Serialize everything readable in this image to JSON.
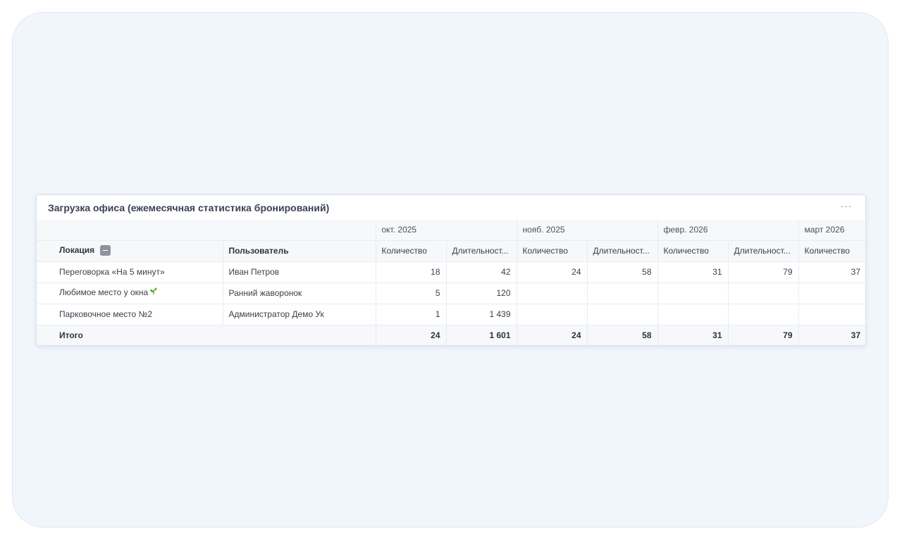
{
  "widget": {
    "title": "Загрузка офиса (ежемесячная статистика бронирований)",
    "more_label": "···"
  },
  "table": {
    "months": [
      "окт. 2025",
      "нояб. 2025",
      "февр. 2026",
      "март 2026"
    ],
    "headers": {
      "location": "Локация",
      "user": "Пользователь",
      "count": "Количество",
      "duration": "Длительност..."
    },
    "rows": [
      {
        "location": "Переговорка «На 5 минут»",
        "user": "Иван Петров",
        "values": [
          "18",
          "42",
          "24",
          "58",
          "31",
          "79",
          "37"
        ]
      },
      {
        "location": "Любимое место у окна",
        "location_icon": "sprout-icon",
        "user": "Ранний жаворонок",
        "values": [
          "5",
          "120",
          "",
          "",
          "",
          "",
          ""
        ]
      },
      {
        "location": "Парковочное место №2",
        "user": "Администратор Демо Ук",
        "values": [
          "1",
          "1 439",
          "",
          "",
          "",
          "",
          ""
        ]
      }
    ],
    "total": {
      "label": "Итого",
      "values": [
        "24",
        "1 601",
        "24",
        "58",
        "31",
        "79",
        "37"
      ]
    }
  },
  "colors": {
    "background": "#f1f5fc",
    "card": "#ffffff",
    "header_bg": "#f7f8fa",
    "icon_gray": "#8c939d",
    "sprout_green": "#5ca636"
  }
}
